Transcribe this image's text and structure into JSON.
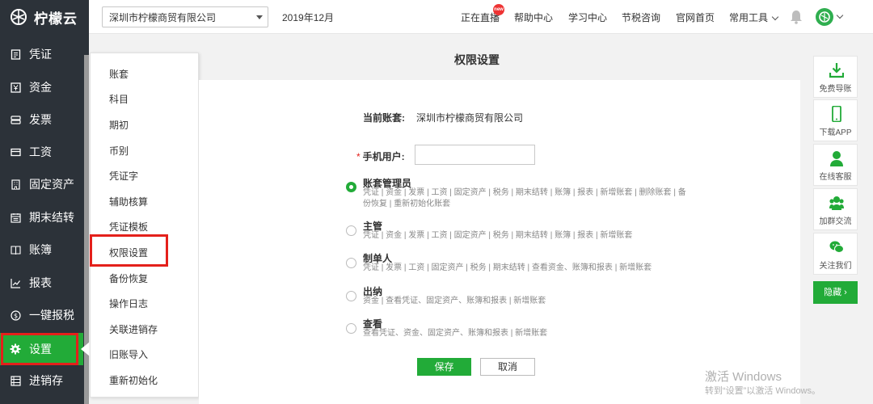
{
  "app": {
    "name": "柠檬云"
  },
  "header": {
    "company": "深圳市柠檬商贸有限公司",
    "period": "2019年12月",
    "nav": [
      "正在直播",
      "帮助中心",
      "学习中心",
      "节税咨询",
      "官网首页"
    ],
    "live_badge": "new",
    "tools_label": "常用工具"
  },
  "sidebar": {
    "items": [
      {
        "label": "凭证",
        "icon": "voucher-icon"
      },
      {
        "label": "资金",
        "icon": "yen-icon"
      },
      {
        "label": "发票",
        "icon": "invoice-icon"
      },
      {
        "label": "工资",
        "icon": "salary-card-icon"
      },
      {
        "label": "固定资产",
        "icon": "building-icon"
      },
      {
        "label": "期末结转",
        "icon": "calendar-icon"
      },
      {
        "label": "账簿",
        "icon": "book-icon"
      },
      {
        "label": "报表",
        "icon": "chart-icon"
      },
      {
        "label": "一键报税",
        "icon": "dollar-circle-icon"
      },
      {
        "label": "设置",
        "icon": "gear-icon",
        "active": true
      },
      {
        "label": "进销存",
        "icon": "inventory-icon"
      }
    ]
  },
  "submenu": {
    "items": [
      "账套",
      "科目",
      "期初",
      "币别",
      "凭证字",
      "辅助核算",
      "凭证模板",
      "权限设置",
      "备份恢复",
      "操作日志",
      "关联进销存",
      "旧账导入",
      "重新初始化"
    ],
    "selected": "权限设置"
  },
  "page": {
    "title": "权限设置",
    "current_account_label": "当前账套:",
    "current_account_value": "深圳市柠檬商贸有限公司",
    "phone_label": "手机用户:",
    "phone_required_mark": "*",
    "phone_value": ""
  },
  "roles": [
    {
      "name": "账套管理员",
      "desc": "凭证 | 资金 | 发票 | 工资 | 固定资产 | 税务 | 期末结转 | 账簿 | 报表 | 新增账套 | 删除账套 | 备份恢复 | 重新初始化账套",
      "checked": true
    },
    {
      "name": "主管",
      "desc": "凭证 | 资金 | 发票 | 工资 | 固定资产 | 税务 | 期末结转 | 账簿 | 报表 | 新增账套",
      "checked": false
    },
    {
      "name": "制单人",
      "desc": "凭证 | 发票 | 工资 | 固定资产 | 税务 | 期末结转 | 查看资金、账簿和报表 | 新增账套",
      "checked": false
    },
    {
      "name": "出纳",
      "desc": "资金 | 查看凭证、固定资产、账簿和报表 | 新增账套",
      "checked": false
    },
    {
      "name": "查看",
      "desc": "查看凭证、资金、固定资产、账簿和报表 | 新增账套",
      "checked": false
    }
  ],
  "buttons": {
    "save": "保存",
    "cancel": "取消"
  },
  "right_toolbar": {
    "items": [
      {
        "label": "免费导账",
        "icon": "download-icon"
      },
      {
        "label": "下载APP",
        "icon": "phone-icon"
      },
      {
        "label": "在线客服",
        "icon": "user-icon"
      },
      {
        "label": "加群交流",
        "icon": "group-icon"
      },
      {
        "label": "关注我们",
        "icon": "wechat-icon"
      }
    ],
    "hide_label": "隐藏 ›"
  },
  "watermark": {
    "title": "激活 Windows",
    "subtitle": "转到“设置”以激活 Windows。"
  },
  "colors": {
    "accent": "#22ab38",
    "sidebar_bg": "#2c3239",
    "highlight_red": "#e4201b"
  }
}
